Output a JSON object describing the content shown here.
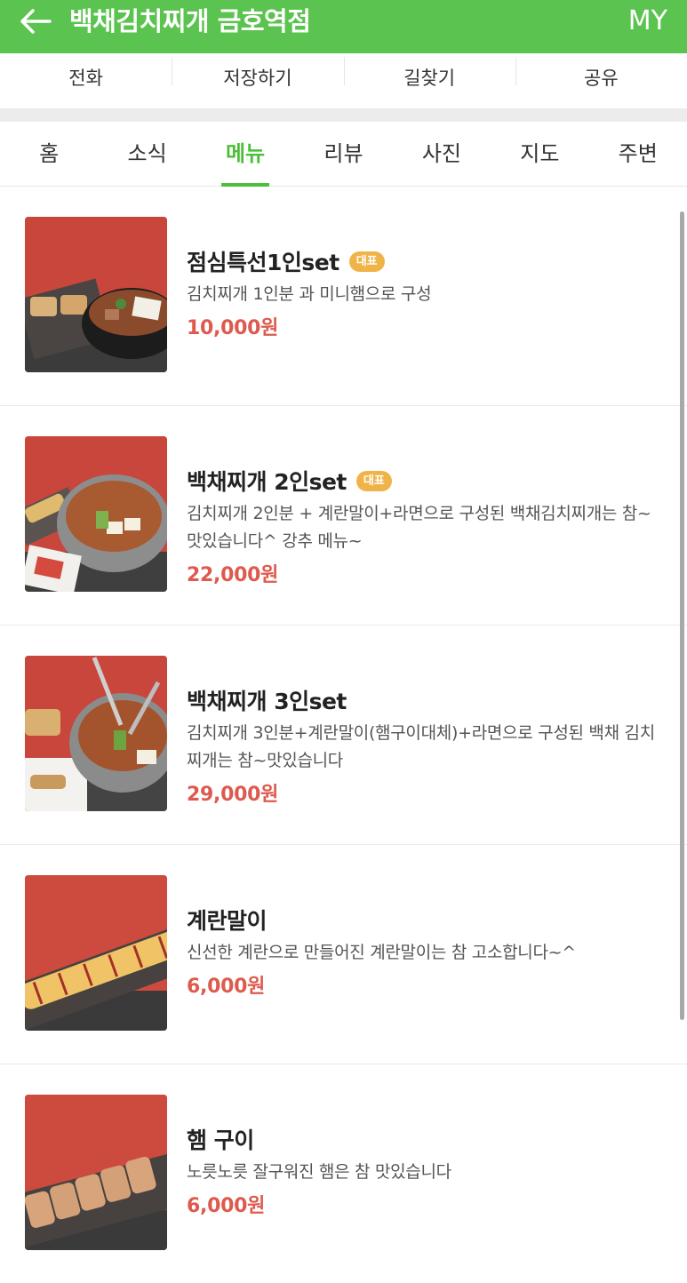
{
  "header": {
    "title": "백채김치찌개 금호역점",
    "my_label": "MY"
  },
  "actions": [
    {
      "label": "전화"
    },
    {
      "label": "저장하기"
    },
    {
      "label": "길찾기"
    },
    {
      "label": "공유"
    }
  ],
  "tabs": [
    {
      "label": "홈"
    },
    {
      "label": "소식"
    },
    {
      "label": "메뉴",
      "active": true
    },
    {
      "label": "리뷰"
    },
    {
      "label": "사진"
    },
    {
      "label": "지도"
    },
    {
      "label": "주변"
    }
  ],
  "menu": [
    {
      "name": "점심특선1인set",
      "badge": "대표",
      "desc": "김치찌개 1인분 과 미니햄으로 구성",
      "price": "10,000원"
    },
    {
      "name": "백채찌개 2인set",
      "badge": "대표",
      "desc": "김치찌개 2인분 + 계란말이+라면으로 구성된 백채김치찌개는 참~ 맛있습니다^ 강추 메뉴~",
      "price": "22,000원"
    },
    {
      "name": "백채찌개 3인set",
      "desc": "김치찌개 3인분+계란말이(햄구이대체)+라면으로 구성된 백채 김치찌개는 참~맛있습니다",
      "price": "29,000원"
    },
    {
      "name": "계란말이",
      "desc": "신선한 계란으로 만들어진 계란말이는 참 고소합니다~^",
      "price": "6,000원"
    },
    {
      "name": "햄 구이",
      "desc": "노릇노릇 잘구워진 햄은 참 맛있습니다",
      "price": "6,000원"
    }
  ],
  "colors": {
    "brand_green": "#5bc34f",
    "price_red": "#de5a4e",
    "badge_orange": "#f0b347"
  }
}
